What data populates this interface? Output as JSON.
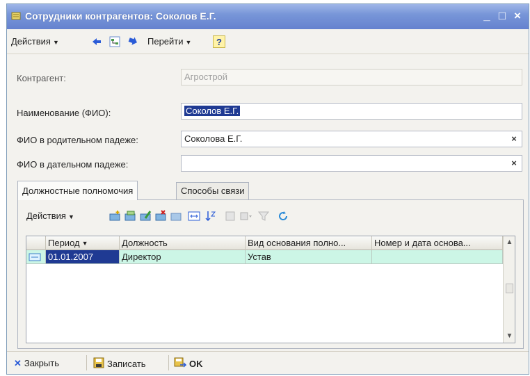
{
  "window": {
    "title": "Сотрудники контрагентов: Соколов Е.Г.",
    "minimize": "_",
    "maximize": "□",
    "close": "×"
  },
  "toolbar": {
    "actions_label": "Действия",
    "goto_label": "Перейти",
    "help_label": "?"
  },
  "form": {
    "kontragent_label": "Контрагент:",
    "kontragent_value": "Агрострой",
    "name_label": "Наименование (ФИО):",
    "name_value": "Соколов Е.Г.",
    "genitive_label": "ФИО в родительном падеже:",
    "genitive_value": "Соколова Е.Г.",
    "dative_label": "ФИО в дательном падеже:",
    "dative_value": "",
    "clear_glyph": "×"
  },
  "tabs": [
    {
      "label": "Должностные полномочия"
    },
    {
      "label": "Способы связи"
    }
  ],
  "tab_toolbar": {
    "actions_label": "Действия"
  },
  "table": {
    "columns": [
      "Период",
      "Должность",
      "Вид основания полно...",
      "Номер и дата основа..."
    ],
    "rows": [
      {
        "period": "01.01.2007",
        "position": "Директор",
        "basis": "Устав",
        "number_date": ""
      }
    ]
  },
  "bottom": {
    "close_label": "Закрыть",
    "save_label": "Записать",
    "ok_label": "OK"
  },
  "colors": {
    "title_bar": "#7896d8",
    "selection": "#1f3a93",
    "row_highlight": "#ccf6e6",
    "window_bg": "#f3f2ee"
  }
}
